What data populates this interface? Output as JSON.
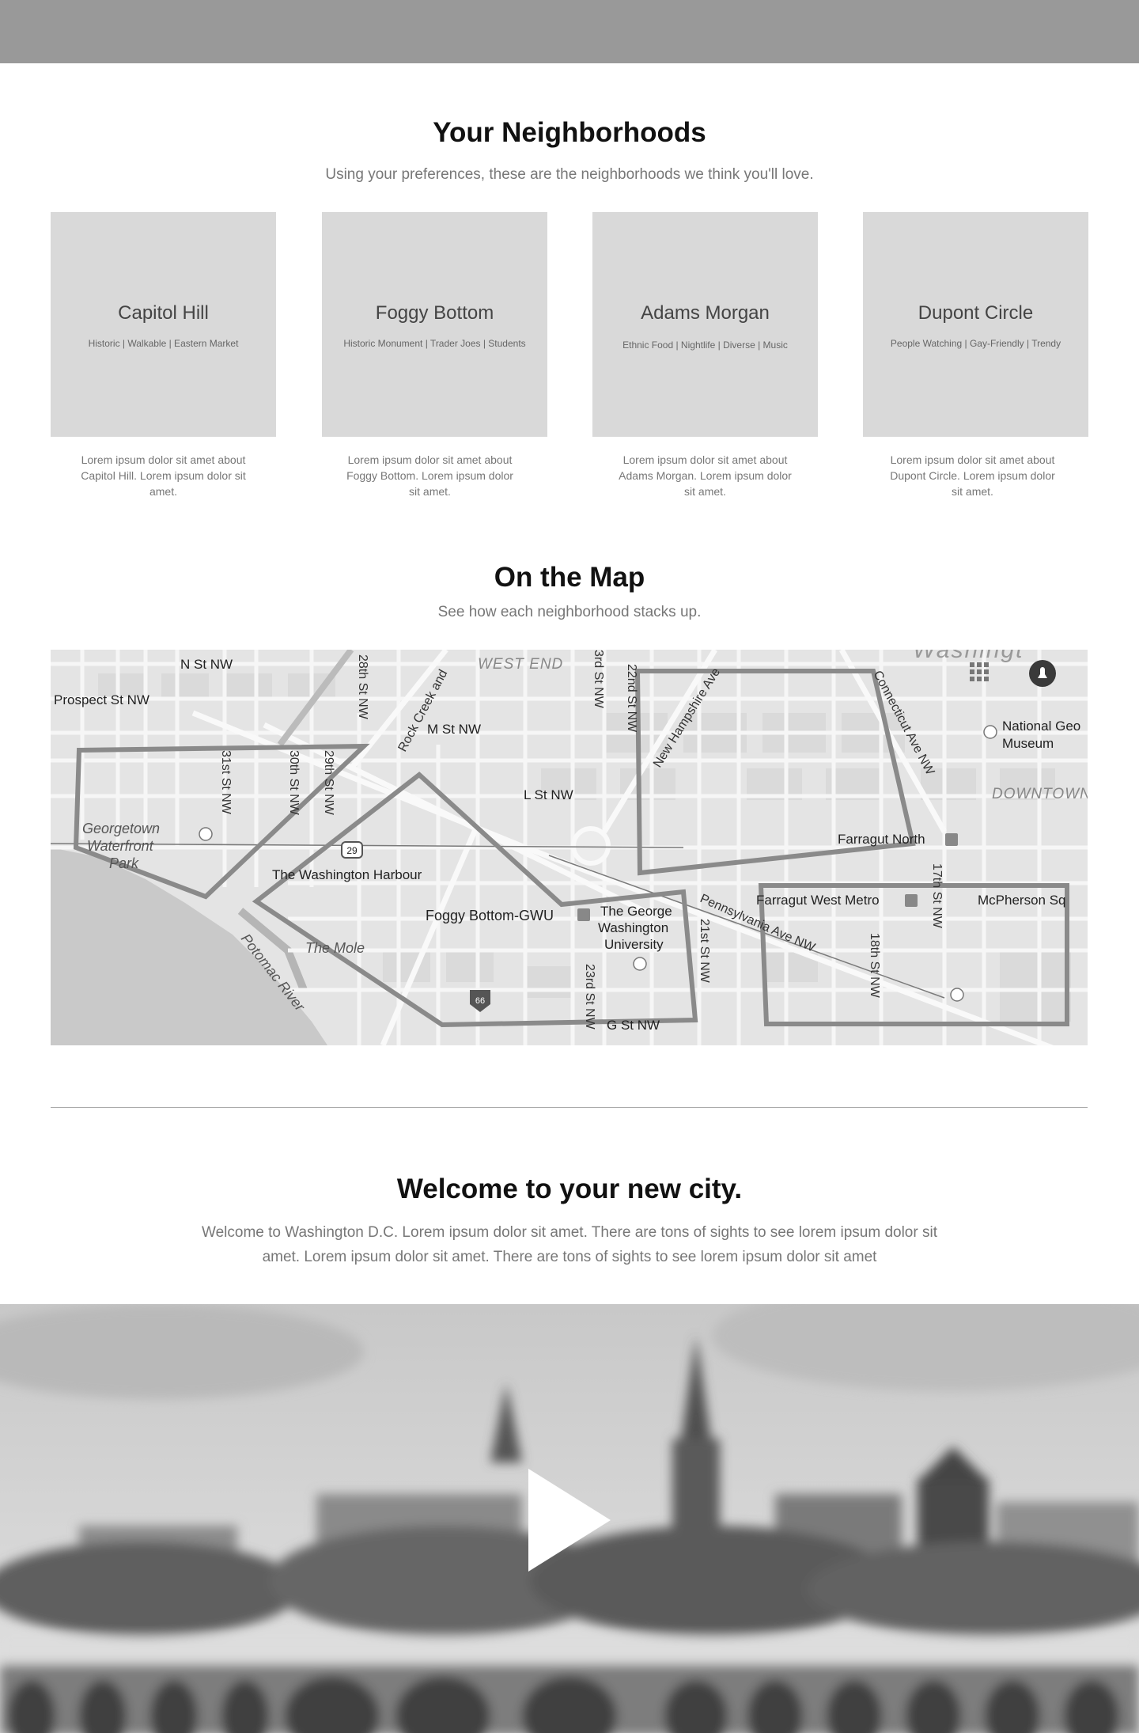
{
  "header": {},
  "neighborhoods": {
    "title": "Your Neighborhoods",
    "subtitle": "Using your preferences, these are the neighborhoods we think you'll love.",
    "cards": [
      {
        "name": "Capitol Hill",
        "tags": "Historic  | Walkable | Eastern Market",
        "description": "Lorem ipsum dolor sit amet about Capitol Hill.  Lorem ipsum dolor sit amet."
      },
      {
        "name": "Foggy Bottom",
        "tags": "Historic Monument  | Trader Joes | Students",
        "description": "Lorem ipsum dolor sit amet about Foggy Bottom.  Lorem ipsum dolor sit amet."
      },
      {
        "name": "Adams Morgan",
        "tags": "Ethnic Food  | Nightlife | Diverse | Music",
        "description": "Lorem ipsum dolor sit amet about Adams Morgan.  Lorem ipsum dolor sit amet."
      },
      {
        "name": "Dupont Circle",
        "tags": "People Watching  | Gay-Friendly | Trendy",
        "description": "Lorem ipsum dolor sit amet about Dupont Circle.  Lorem ipsum dolor sit amet."
      }
    ]
  },
  "map_section": {
    "title": "On the Map",
    "subtitle": "See how each neighborhood stacks up.",
    "labels": {
      "n_st": "N St NW",
      "prospect": "Prospect St NW",
      "west_end": "WEST END",
      "m_st": "M St NW",
      "l_st": "L St NW",
      "g_st": "G St NW",
      "georgetown1": "Georgetown",
      "georgetown2": "Waterfront",
      "georgetown3": "Park",
      "harbour": "The Washington Harbour",
      "foggy_metro": "Foggy Bottom-GWU",
      "gwu1": "The George",
      "gwu2": "Washington",
      "gwu3": "University",
      "mole": "The Mole",
      "potomac": "Potomac River",
      "farragut_north": "Farragut North",
      "farragut_west": "Farragut West Metro",
      "mcpherson": "McPherson Sq",
      "pennsylvania": "Pennsylvania Ave NW",
      "downtown": "DOWNTOWN",
      "national1": "National Geo",
      "national2": "Museum",
      "washington": "Washingt",
      "st31": "31st St NW",
      "st30": "30th St NW",
      "st29": "29th St NW",
      "st28": "28th St NW",
      "rock_creek": "Rock Creek and",
      "st23": "23rd St NW",
      "st22": "22nd St NW",
      "st21": "21st St NW",
      "st18": "18th St NW",
      "st17": "17th St NW",
      "new_hampshire": "New Hampshire Ave",
      "connecticut": "Connecticut Ave NW",
      "rd_st": "3rd St NW",
      "shield_29": "29",
      "shield_66": "66"
    }
  },
  "welcome": {
    "title": "Welcome to your new city.",
    "body": "Welcome to Washington D.C. Lorem ipsum dolor sit amet. There are tons of sights to see lorem ipsum dolor sit amet. Lorem ipsum dolor sit amet. There are tons of sights to see lorem ipsum dolor sit amet"
  },
  "video": {
    "play_icon": "play-icon"
  }
}
